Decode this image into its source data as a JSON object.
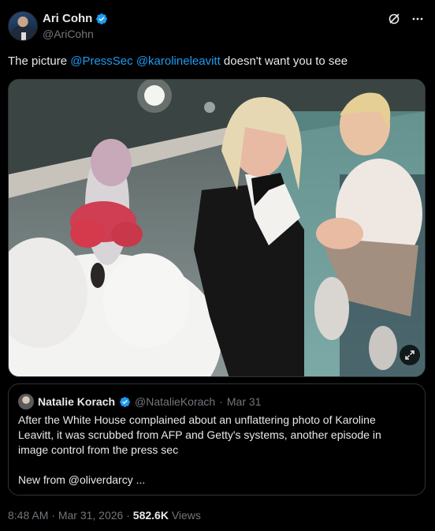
{
  "author": {
    "display_name": "Ari Cohn",
    "handle": "@AriCohn"
  },
  "tweet": {
    "text_prefix": "The picture ",
    "mention_1": "@PressSec",
    "space": " ",
    "mention_2": "@karolineleavitt",
    "text_suffix": " doesn't want you to see"
  },
  "quote": {
    "name": "Natalie Korach",
    "handle": "@NatalieKorach",
    "separator": " · ",
    "date": "Mar 31",
    "body_1": "After the White House complained about an unflattering photo of Karoline Leavitt, it was scrubbed from AFP and Getty's systems, another episode in image control from the press sec",
    "body_2": "New from @oliverdarcy ..."
  },
  "meta": {
    "time": "8:48 AM",
    "separator": " · ",
    "date": "Mar 31, 2026",
    "views_count": "582.6K",
    "views_label": "Views"
  },
  "icons": {
    "verified": "verified-badge-icon",
    "grok": "grok-icon",
    "more": "more-icon",
    "expand": "expand-icon"
  },
  "colors": {
    "background": "#000000",
    "text": "#e7e9ea",
    "muted": "#71767b",
    "accent": "#1d9bf0",
    "border": "#2f3336"
  }
}
